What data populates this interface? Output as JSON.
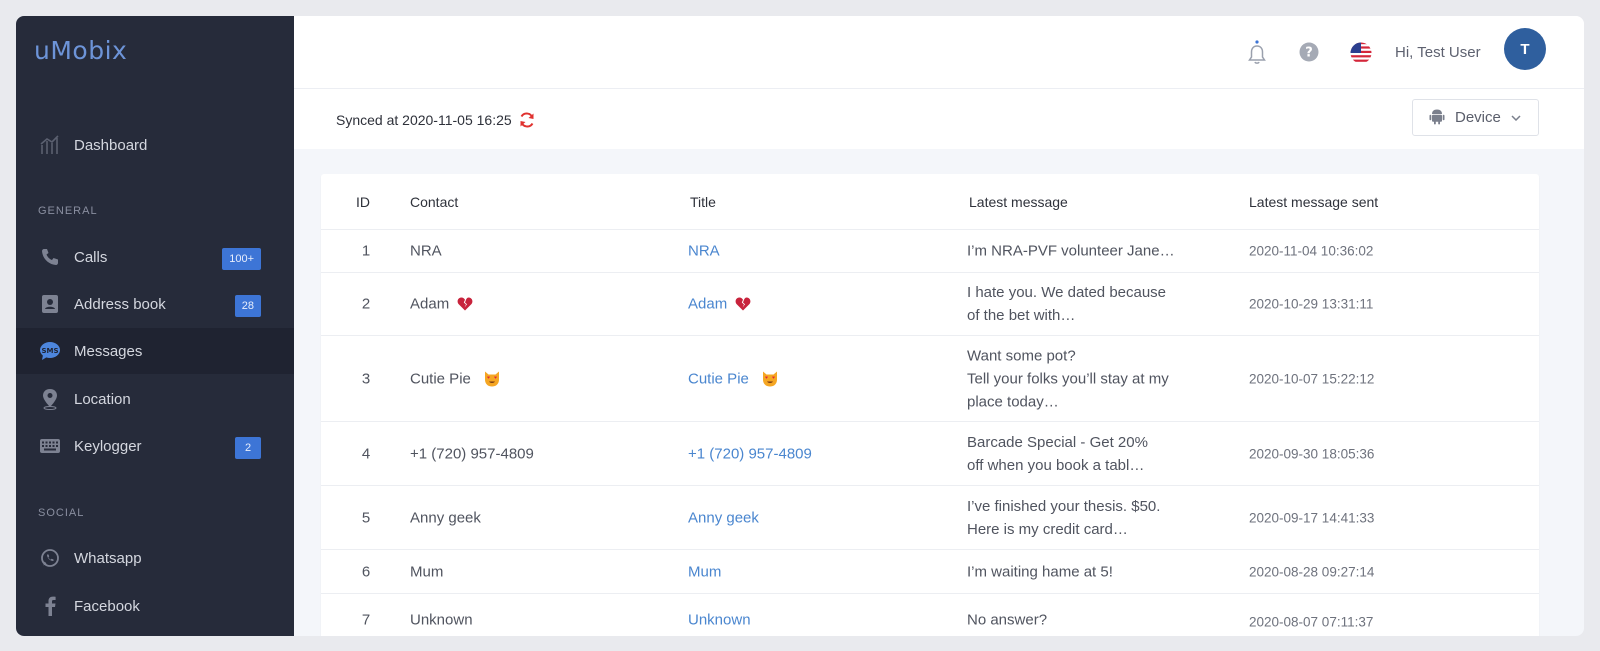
{
  "app": {
    "logo": "uMobix"
  },
  "sidebar": {
    "dashboard": "Dashboard",
    "general_label": "GENERAL",
    "social_label": "SOCIAL",
    "items": [
      {
        "label": "Calls",
        "badge": "100+"
      },
      {
        "label": "Address book",
        "badge": "28"
      },
      {
        "label": "Messages",
        "badge": ""
      },
      {
        "label": "Location",
        "badge": ""
      },
      {
        "label": "Keylogger",
        "badge": "2"
      }
    ],
    "social": [
      {
        "label": "Whatsapp"
      },
      {
        "label": "Facebook"
      }
    ]
  },
  "topbar": {
    "greeting": "Hi, Test User",
    "avatar_initial": "T"
  },
  "sync": {
    "text": "Synced at 2020-11-05 16:25",
    "device_label": "Device"
  },
  "table": {
    "headers": {
      "id": "ID",
      "contact": "Contact",
      "title": "Title",
      "latest_message": "Latest message",
      "latest_sent": "Latest message sent"
    },
    "rows": [
      {
        "id": "1",
        "contact": "NRA",
        "title": "NRA",
        "message_1": "I’m NRA-PVF volunteer Jane…",
        "message_2": "",
        "message_3": "",
        "sent": "2020-11-04 10:36:02"
      },
      {
        "id": "2",
        "contact": "Adam",
        "title": "Adam",
        "message_1": "I hate you. We dated because",
        "message_2": "of the bet with…",
        "message_3": "",
        "sent": "2020-10-29 13:31:11"
      },
      {
        "id": "3",
        "contact": "Cutie Pie",
        "title": "Cutie Pie",
        "message_1": "Want some pot?",
        "message_2": "Tell your folks you’ll stay at my",
        "message_3": "place today…",
        "sent": "2020-10-07 15:22:12"
      },
      {
        "id": "4",
        "contact": "+1 (720) 957-4809",
        "title": "+1 (720) 957-4809",
        "message_1": "Barcade Special - Get 20%",
        "message_2": "off when you book a tabl…",
        "message_3": "",
        "sent": "2020-09-30 18:05:36"
      },
      {
        "id": "5",
        "contact": "Anny geek",
        "title": "Anny geek",
        "message_1": "I’ve finished your thesis. $50.",
        "message_2": "Here is my credit card…",
        "message_3": "",
        "sent": "2020-09-17 14:41:33"
      },
      {
        "id": "6",
        "contact": "Mum",
        "title": "Mum",
        "message_1": "I’m waiting hame at 5!",
        "message_2": "",
        "message_3": "",
        "sent": "2020-08-28 09:27:14"
      },
      {
        "id": "7",
        "contact": "Unknown",
        "title": "Unknown",
        "message_1": "No answer?",
        "message_2": "",
        "message_3": "",
        "sent": "2020-08-07 07:11:37"
      }
    ]
  },
  "icons": {
    "dashboard": "bar-chart-icon",
    "calls": "phone-icon",
    "address_book": "contact-book-icon",
    "messages": "sms-bubble-icon",
    "location": "map-pin-icon",
    "keylogger": "keyboard-icon",
    "whatsapp": "whatsapp-icon",
    "facebook": "facebook-icon",
    "bell": "bell-icon",
    "help": "help-circle-icon",
    "flag": "us-flag-icon",
    "refresh": "refresh-icon",
    "android": "android-icon",
    "chevron": "chevron-down-icon",
    "broken_heart": "broken-heart-emoji",
    "cat_heart_eyes": "cat-heart-eyes-emoji"
  },
  "colors": {
    "sidebar_bg": "#262b3a",
    "accent": "#3d75d6",
    "link": "#4a86cf",
    "refresh": "#e0322f"
  }
}
